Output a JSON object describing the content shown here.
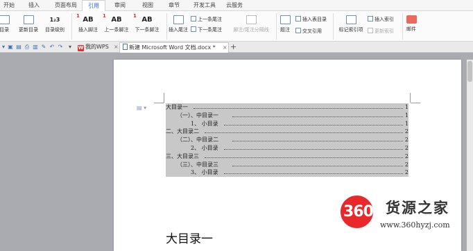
{
  "menu": {
    "tabs": [
      "开始",
      "插入",
      "页面布局",
      "引用",
      "审阅",
      "视图",
      "章节",
      "开发工具",
      "云服务"
    ],
    "active": "引用"
  },
  "ribbon": {
    "toc": "目录",
    "update_toc": "更新目录",
    "toc_level": "目录级别",
    "insert_footnote": "插入脚注",
    "prev_footnote": "上一条脚注",
    "next_footnote": "下一条脚注",
    "insert_endnote": "插入尾注",
    "prev_endnote": "上一条尾注",
    "next_endnote": "下一条尾注",
    "footnote_sep": "脚注/尾注分隔线",
    "caption": "题注",
    "insert_table_toc": "插入表目录",
    "cross_ref": "交叉引用",
    "mark_index": "标记索引项",
    "insert_index": "插入索引",
    "update_index": "更新索引",
    "mail": "邮件",
    "footnote_glyph": "AB",
    "footnote_sup": "1",
    "toc_level_glyph": "1₂3"
  },
  "tabs": {
    "wps_tab": "我的WPS",
    "doc_tab": "新建 Microsoft Word 文档.docx *",
    "close": "×",
    "new_tab": "+"
  },
  "document": {
    "toc": [
      {
        "text": "大目录一",
        "page": "1"
      },
      {
        "text": "（一）、中目录一",
        "page": "1"
      },
      {
        "text": "1、 小目录",
        "page": "1"
      },
      {
        "text": "二、大目录二",
        "page": "2"
      },
      {
        "text": "（二）、中目录二",
        "page": "2"
      },
      {
        "text": "2、 小目录",
        "page": "2"
      },
      {
        "text": "三、大目录三",
        "page": "2"
      },
      {
        "text": "（三）、中目录三",
        "page": "2"
      },
      {
        "text": "3、 小目录",
        "page": "2"
      }
    ],
    "heading": "大目录一"
  },
  "watermark": {
    "number": "360",
    "name": "货源之家",
    "url": "www.360hyzj.com"
  }
}
